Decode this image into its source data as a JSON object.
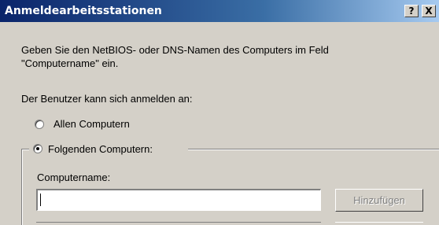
{
  "window": {
    "title": "Anmeldearbeitsstationen",
    "help_button": "?",
    "close_button": "X"
  },
  "description": {
    "line1": "Geben Sie den NetBIOS- oder DNS-Namen des Computers im Feld",
    "line2": "\"Computername\" ein."
  },
  "logon_intro": "Der Benutzer kann sich anmelden an:",
  "options": {
    "all_computers": {
      "label": "Allen Computern",
      "checked": false
    },
    "following_computers": {
      "label": "Folgenden Computern:",
      "checked": true
    }
  },
  "computer_name": {
    "label": "Computername:",
    "value": "",
    "add_button": "Hinzufügen",
    "add_button_enabled": false
  }
}
